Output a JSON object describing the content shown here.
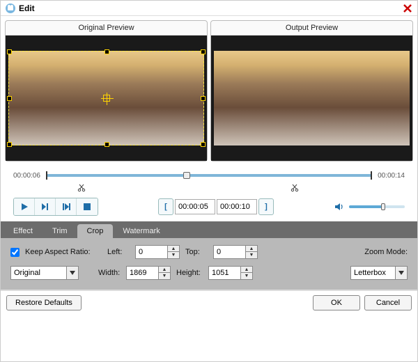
{
  "window": {
    "title": "Edit"
  },
  "preview": {
    "original_label": "Original Preview",
    "output_label": "Output Preview"
  },
  "timeline": {
    "position": "00:00:06",
    "duration": "00:00:14",
    "in_point": "00:00:05",
    "out_point": "00:00:10"
  },
  "tabs": {
    "effect": "Effect",
    "trim": "Trim",
    "crop": "Crop",
    "watermark": "Watermark",
    "active": "Crop"
  },
  "crop": {
    "keep_ar_label": "Keep Aspect Ratio:",
    "keep_ar_checked": true,
    "aspect_value": "Original",
    "left_label": "Left:",
    "left_value": "0",
    "top_label": "Top:",
    "top_value": "0",
    "width_label": "Width:",
    "width_value": "1869",
    "height_label": "Height:",
    "height_value": "1051",
    "zoom_label": "Zoom Mode:",
    "zoom_value": "Letterbox"
  },
  "footer": {
    "restore": "Restore Defaults",
    "ok": "OK",
    "cancel": "Cancel"
  },
  "icons": {
    "app": "app-icon",
    "close": "close-icon",
    "play": "play-icon",
    "step": "step-icon",
    "next": "next-icon",
    "stop": "stop-icon",
    "scissor": "scissor-icon",
    "bracket_open": "bracket-open-icon",
    "bracket_close": "bracket-close-icon",
    "volume": "volume-icon",
    "chevron": "chevron-down-icon",
    "spin_up": "spin-up-icon",
    "spin_down": "spin-down-icon"
  }
}
